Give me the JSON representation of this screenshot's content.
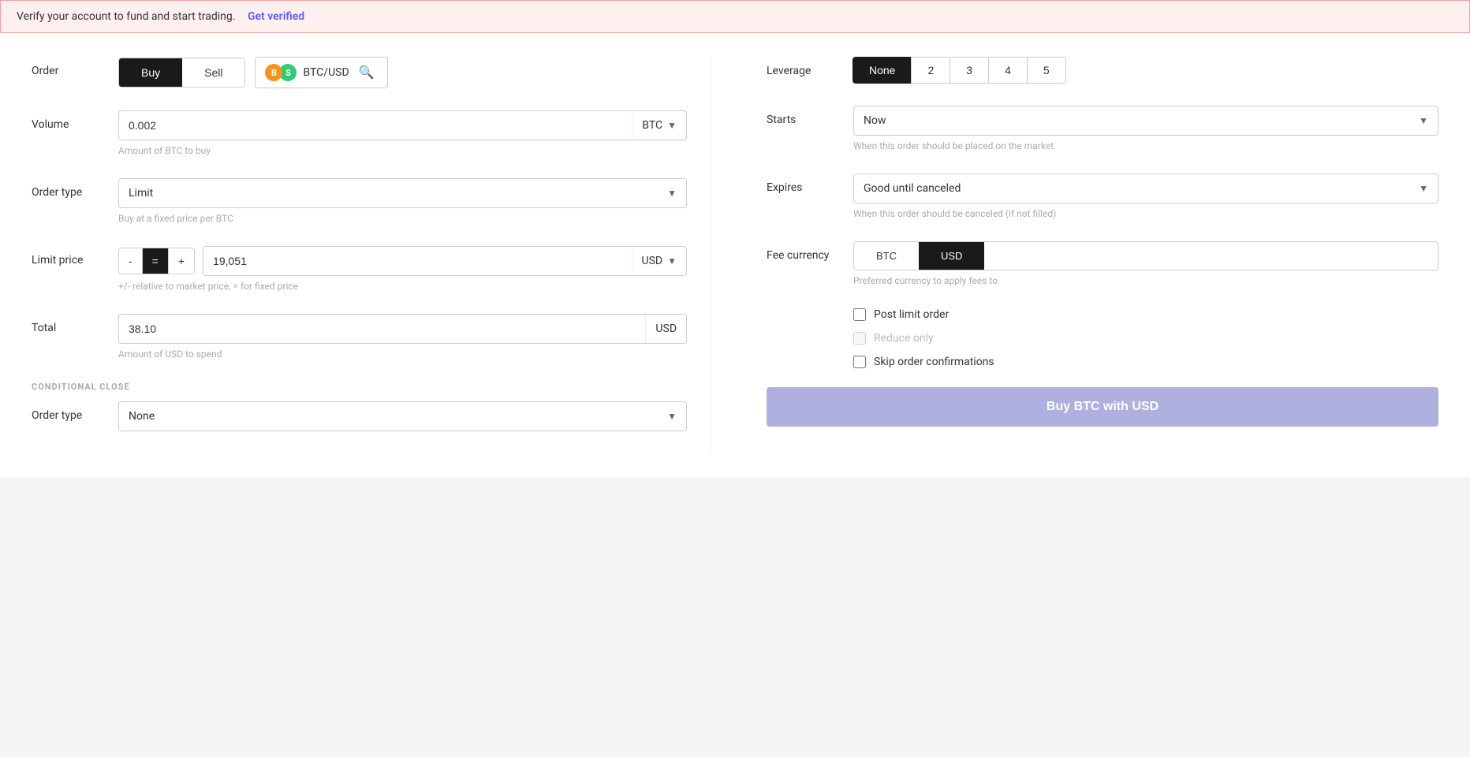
{
  "alert": {
    "message": "Verify your account to fund and start trading.",
    "link_text": "Get verified"
  },
  "order": {
    "label": "Order",
    "buy_label": "Buy",
    "sell_label": "Sell",
    "pair": "BTC/USD"
  },
  "leverage": {
    "label": "Leverage",
    "options": [
      "None",
      "2",
      "3",
      "4",
      "5"
    ],
    "selected": "None"
  },
  "volume": {
    "label": "Volume",
    "value": "0.002",
    "currency": "BTC",
    "helper": "Amount of BTC to buy"
  },
  "starts": {
    "label": "Starts",
    "value": "Now",
    "helper": "When this order should be placed on the market"
  },
  "order_type": {
    "label": "Order type",
    "value": "Limit",
    "helper": "Buy at a fixed price per BTC"
  },
  "expires": {
    "label": "Expires",
    "value": "Good until canceled",
    "helper": "When this order should be canceled (if not filled)"
  },
  "limit_price": {
    "label": "Limit price",
    "minus": "-",
    "equal": "=",
    "plus": "+",
    "value": "19,051",
    "currency": "USD",
    "helper": "+/- relative to market price, = for fixed price"
  },
  "fee_currency": {
    "label": "Fee currency",
    "btc_label": "BTC",
    "usd_label": "USD",
    "helper": "Preferred currency to apply fees to"
  },
  "total": {
    "label": "Total",
    "value": "38.10",
    "currency": "USD",
    "helper": "Amount of USD to spend"
  },
  "checkboxes": {
    "post_limit": {
      "label": "Post limit order",
      "checked": false
    },
    "reduce_only": {
      "label": "Reduce only",
      "checked": false,
      "disabled": true
    },
    "skip_confirmations": {
      "label": "Skip order confirmations",
      "checked": false
    }
  },
  "conditional_close": {
    "section_label": "CONDITIONAL CLOSE",
    "order_type_label": "Order type",
    "order_type_value": "None"
  },
  "buy_button": {
    "label": "Buy BTC with USD"
  }
}
